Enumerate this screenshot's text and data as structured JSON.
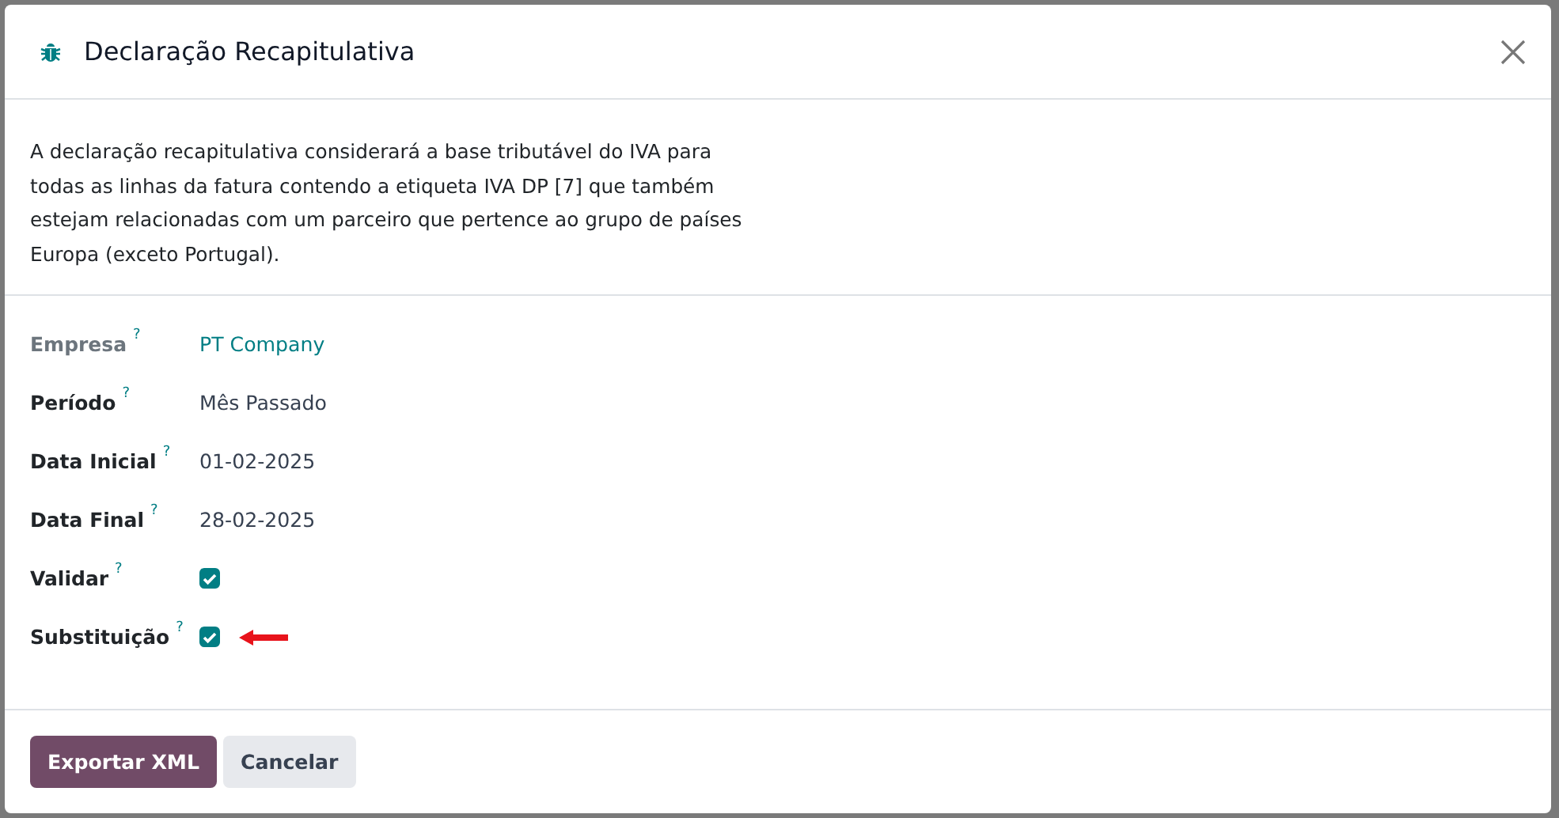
{
  "dialog": {
    "title": "Declaração Recapitulativa",
    "description": "A declaração recapitulativa considerará a base tributável do IVA para todas as linhas da fatura contendo a etiqueta IVA DP [7] que também estejam relacionadas com um parceiro que pertence ao grupo de países Europa (exceto Portugal).",
    "fields": [
      {
        "label": "Empresa",
        "help": "?",
        "kind": "link",
        "value": "PT Company",
        "readonly": true,
        "arrow": false
      },
      {
        "label": "Período",
        "help": "?",
        "kind": "text",
        "value": "Mês Passado",
        "readonly": false,
        "arrow": false
      },
      {
        "label": "Data Inicial",
        "help": "?",
        "kind": "text",
        "value": "01-02-2025",
        "readonly": false,
        "arrow": false
      },
      {
        "label": "Data Final",
        "help": "?",
        "kind": "text",
        "value": "28-02-2025",
        "readonly": false,
        "arrow": false
      },
      {
        "label": "Validar",
        "help": "?",
        "kind": "checkbox",
        "checked": true,
        "readonly": false,
        "arrow": false
      },
      {
        "label": "Substituição",
        "help": "?",
        "kind": "checkbox",
        "checked": true,
        "readonly": false,
        "arrow": true
      }
    ],
    "buttons": [
      {
        "label": "Exportar XML",
        "kind": "primary"
      },
      {
        "label": "Cancelar",
        "kind": "secondary"
      }
    ]
  }
}
